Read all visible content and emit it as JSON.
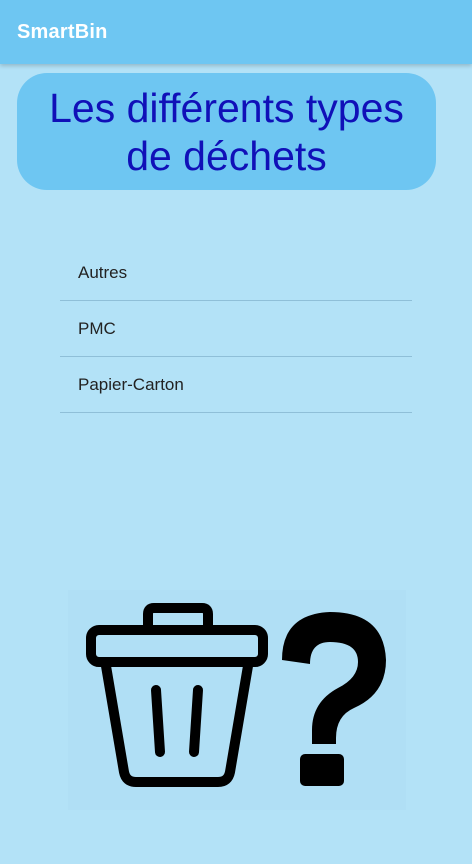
{
  "app_bar": {
    "title": "SmartBin"
  },
  "header": {
    "line1": "Les différents types",
    "line2": "de déchets"
  },
  "waste_types": [
    {
      "label": "Autres"
    },
    {
      "label": "PMC"
    },
    {
      "label": "Papier-Carton"
    }
  ],
  "illustration": {
    "icon": "trash-can-question-mark-icon"
  },
  "colors": {
    "background": "#b3e2f7",
    "app_bar": "#6ec6f2",
    "header_text": "#1010b8"
  }
}
